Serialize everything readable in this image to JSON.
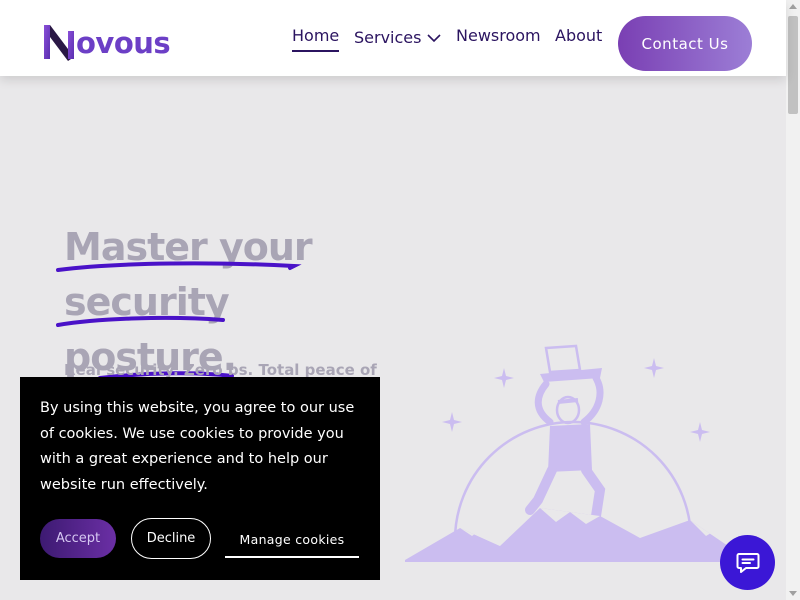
{
  "header": {
    "logo_text": "ovous",
    "nav": {
      "home": "Home",
      "services": "Services",
      "newsroom": "Newsroom",
      "about": "About"
    },
    "contact_button": "Contact Us"
  },
  "hero": {
    "title_lines": [
      "Master your",
      "security",
      "posture."
    ],
    "subtitle": "Real security. Zero bs. Total peace of"
  },
  "cookie_banner": {
    "text": "By using this website, you agree to our use of cookies. We use cookies to provide you with a great experience and to help our website run effectively.",
    "accept": "Accept",
    "decline": "Decline",
    "manage": "Manage cookies"
  },
  "icons": {
    "chevron": "chevron-down-icon",
    "chat": "chat-icon"
  },
  "colors": {
    "brand_purple": "#6c3fc6",
    "nav_text": "#2b1460",
    "underline": "#4a12c8",
    "hero_text": "#a9a5b5",
    "chat_button": "#3b17d6",
    "illustration": "#cbbdf0"
  }
}
